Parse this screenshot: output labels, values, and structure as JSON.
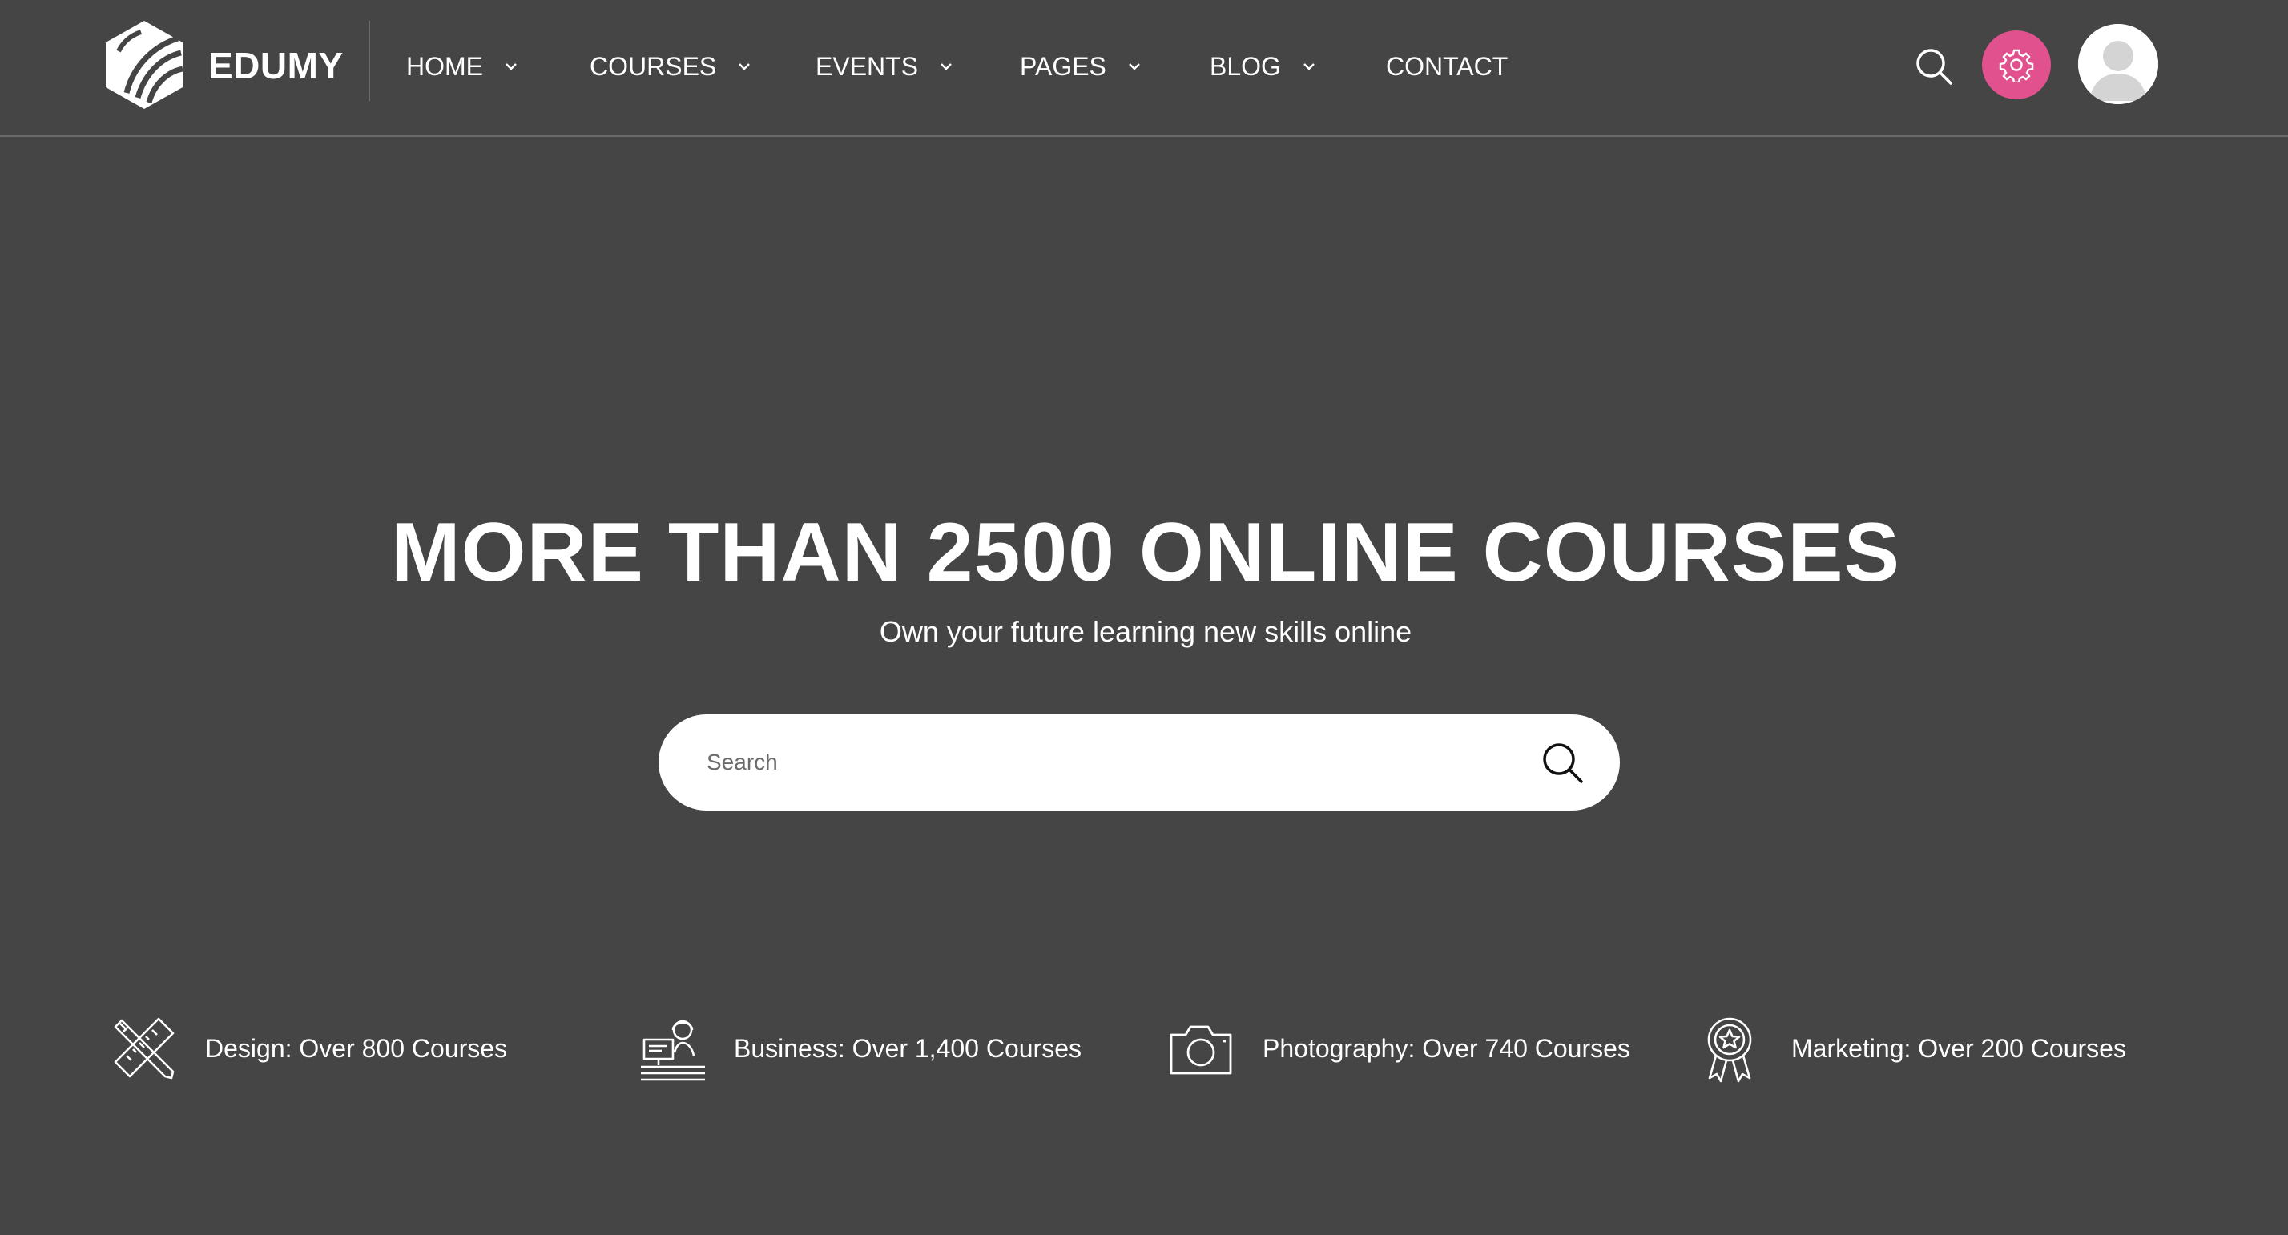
{
  "brand": {
    "name": "EDUMY",
    "logo_icon": "edumy-logo-icon"
  },
  "nav": {
    "items": [
      {
        "label": "HOME",
        "has_dropdown": true
      },
      {
        "label": "COURSES",
        "has_dropdown": true
      },
      {
        "label": "EVENTS",
        "has_dropdown": true
      },
      {
        "label": "PAGES",
        "has_dropdown": true
      },
      {
        "label": "BLOG",
        "has_dropdown": true
      },
      {
        "label": "CONTACT",
        "has_dropdown": false
      }
    ]
  },
  "header_actions": {
    "search_icon": "search-icon",
    "settings_icon": "gear-icon",
    "avatar_icon": "user-avatar-icon"
  },
  "hero": {
    "title": "MORE THAN 2500 ONLINE COURSES",
    "subtitle": "Own your future learning new skills online",
    "search": {
      "placeholder": "Search",
      "value": ""
    }
  },
  "categories": [
    {
      "label": "Design: Over 800 Courses",
      "icon": "pencil-ruler-icon"
    },
    {
      "label": "Business: Over 1,400 Courses",
      "icon": "business-desk-icon"
    },
    {
      "label": "Photography: Over 740 Courses",
      "icon": "camera-icon"
    },
    {
      "label": "Marketing: Over 200 Courses",
      "icon": "award-badge-icon"
    }
  ],
  "colors": {
    "background": "#454545",
    "accent": "#e0518e",
    "text": "#ffffff",
    "divider": "#6a6a6a"
  }
}
